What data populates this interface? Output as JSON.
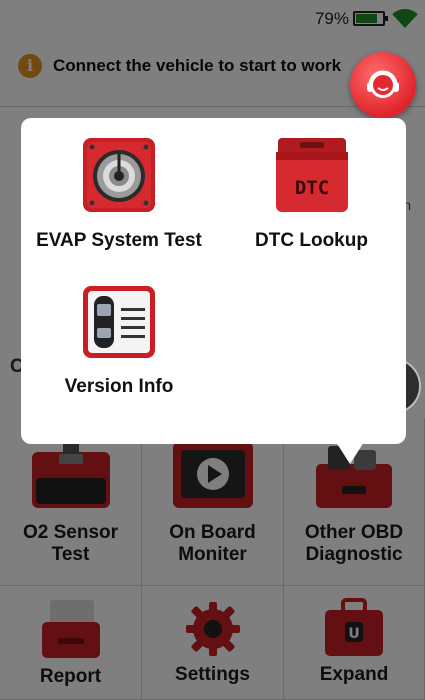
{
  "status": {
    "battery_percent": "79%",
    "battery_level": 0.79
  },
  "banner": {
    "text": "Connect the vehicle to start to work"
  },
  "background": {
    "partial_left_text": "C",
    "partial_right_text": "n"
  },
  "grid": {
    "o2": {
      "line1": "O2 Sensor",
      "line2": "Test"
    },
    "onboard": {
      "line1": "On Board",
      "line2": "Moniter"
    },
    "other": {
      "line1": "Other OBD",
      "line2": "Diagnostic"
    },
    "report": "Report",
    "settings": "Settings",
    "expand": "Expand"
  },
  "popup": {
    "evap": "EVAP System Test",
    "dtc": "DTC Lookup",
    "dtc_icon_text": "DTC",
    "version": "Version Info"
  },
  "colors": {
    "accent_red": "#d92a2f",
    "dark_red": "#a8151b",
    "info_orange": "#e4941a"
  },
  "icons": {
    "wifi": "wifi-icon",
    "battery": "battery-icon",
    "info": "info-icon",
    "support": "customer-support-icon",
    "camera": "camera-icon"
  }
}
